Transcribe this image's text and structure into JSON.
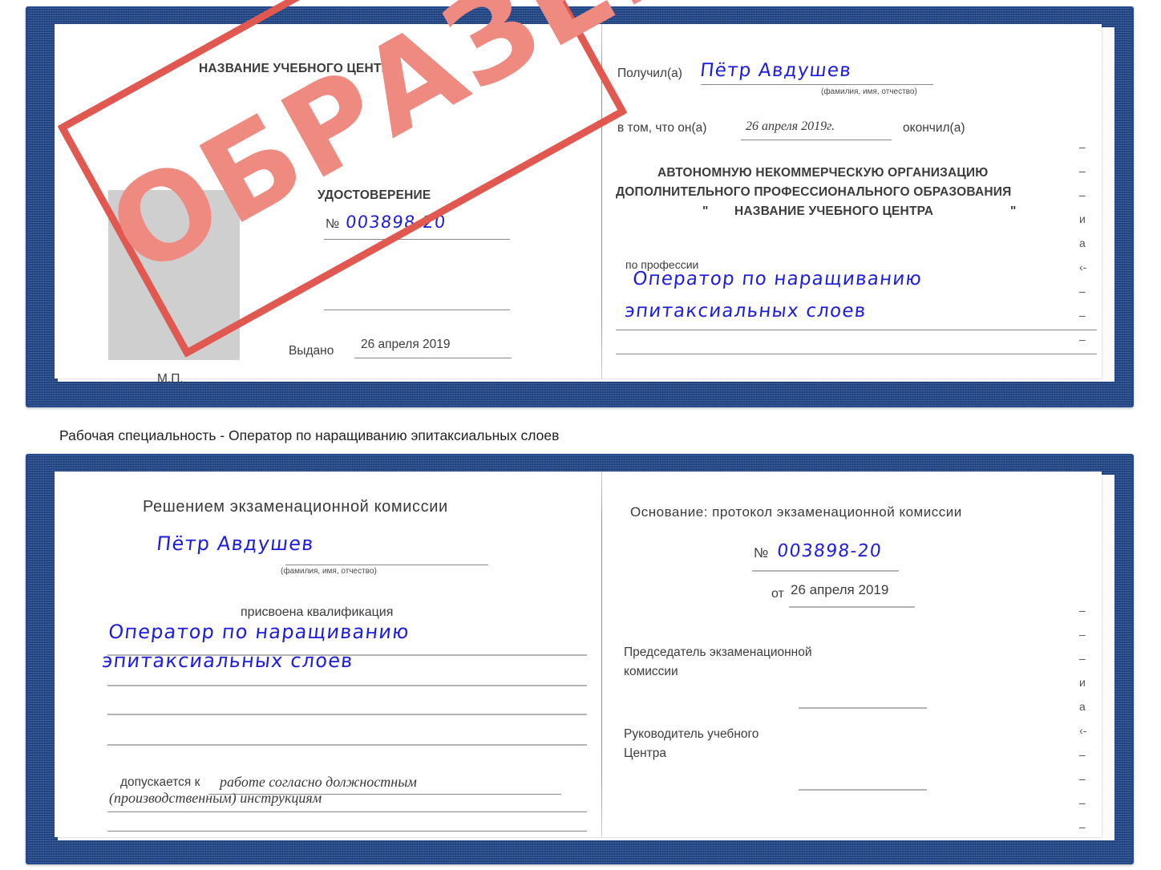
{
  "caption": "Рабочая специальность - Оператор по наращиванию эпитаксиальных слоев",
  "stamp": {
    "text": "ОБРАЗЕЦ",
    "color": "#ef8a80",
    "frame_color": "#e0584f"
  },
  "colors": {
    "cover": "#22488a",
    "ink": "#1d1ddd",
    "rule": "#9b9b9b",
    "photo": "#cfcfcf"
  },
  "certificate_top": {
    "left_page": {
      "center_name": "НАЗВАНИЕ УЧЕБНОГО ЦЕНТРА",
      "doc_title": "УДОСТОВЕРЕНИЕ",
      "number_label": "№",
      "number_value": "003898-20",
      "issued_label": "Выдано",
      "issued_value": "26 апреля 2019",
      "seal_label": "М.П."
    },
    "right_page": {
      "received_label": "Получил(а)",
      "received_value": "Пётр Авдушев",
      "fio_hint": "(фамилия, имя, отчество)",
      "in_that_label": "в том, что он(а)",
      "date_value": "26 апреля 2019г.",
      "finished_label": "окончил(а)",
      "org_line1": "АВТОНОМНУЮ НЕКОММЕРЧЕСКУЮ ОРГАНИЗАЦИЮ",
      "org_line2": "ДОПОЛНИТЕЛЬНОГО ПРОФЕССИОНАЛЬНОГО ОБРАЗОВАНИЯ",
      "org_quote_open": "\"",
      "org_name": "НАЗВАНИЕ УЧЕБНОГО ЦЕНТРА",
      "org_quote_close": "\"",
      "profession_label": "по профессии",
      "profession_value_line1": "Оператор по наращиванию",
      "profession_value_line2": "эпитаксиальных слоев"
    },
    "edge_glyphs": [
      "–",
      "–",
      "–",
      "и",
      "а",
      "‹-",
      "–",
      "–",
      "–"
    ]
  },
  "certificate_bottom": {
    "left_page": {
      "heading": "Решением экзаменационной комиссии",
      "name_value": "Пётр Авдушев",
      "fio_hint": "(фамилия, имя, отчество)",
      "qualification_label": "присвоена квалификация",
      "qualification_line1": "Оператор по наращиванию",
      "qualification_line2": "эпитаксиальных слоев",
      "admitted_label": "допускается к",
      "admitted_line1": "работе согласно должностным",
      "admitted_line2": "(производственным) инструкциям"
    },
    "right_page": {
      "basis_label": "Основание: протокол экзаменационной комиссии",
      "number_label": "№",
      "number_value": "003898-20",
      "from_label": "от",
      "from_value": "26 апреля 2019",
      "chairman_line1": "Председатель экзаменационной",
      "chairman_line2": "комиссии",
      "head_line1": "Руководитель учебного",
      "head_line2": "Центра"
    },
    "edge_glyphs": [
      "–",
      "–",
      "–",
      "и",
      "а",
      "‹-",
      "–",
      "–",
      "–",
      "–"
    ]
  }
}
